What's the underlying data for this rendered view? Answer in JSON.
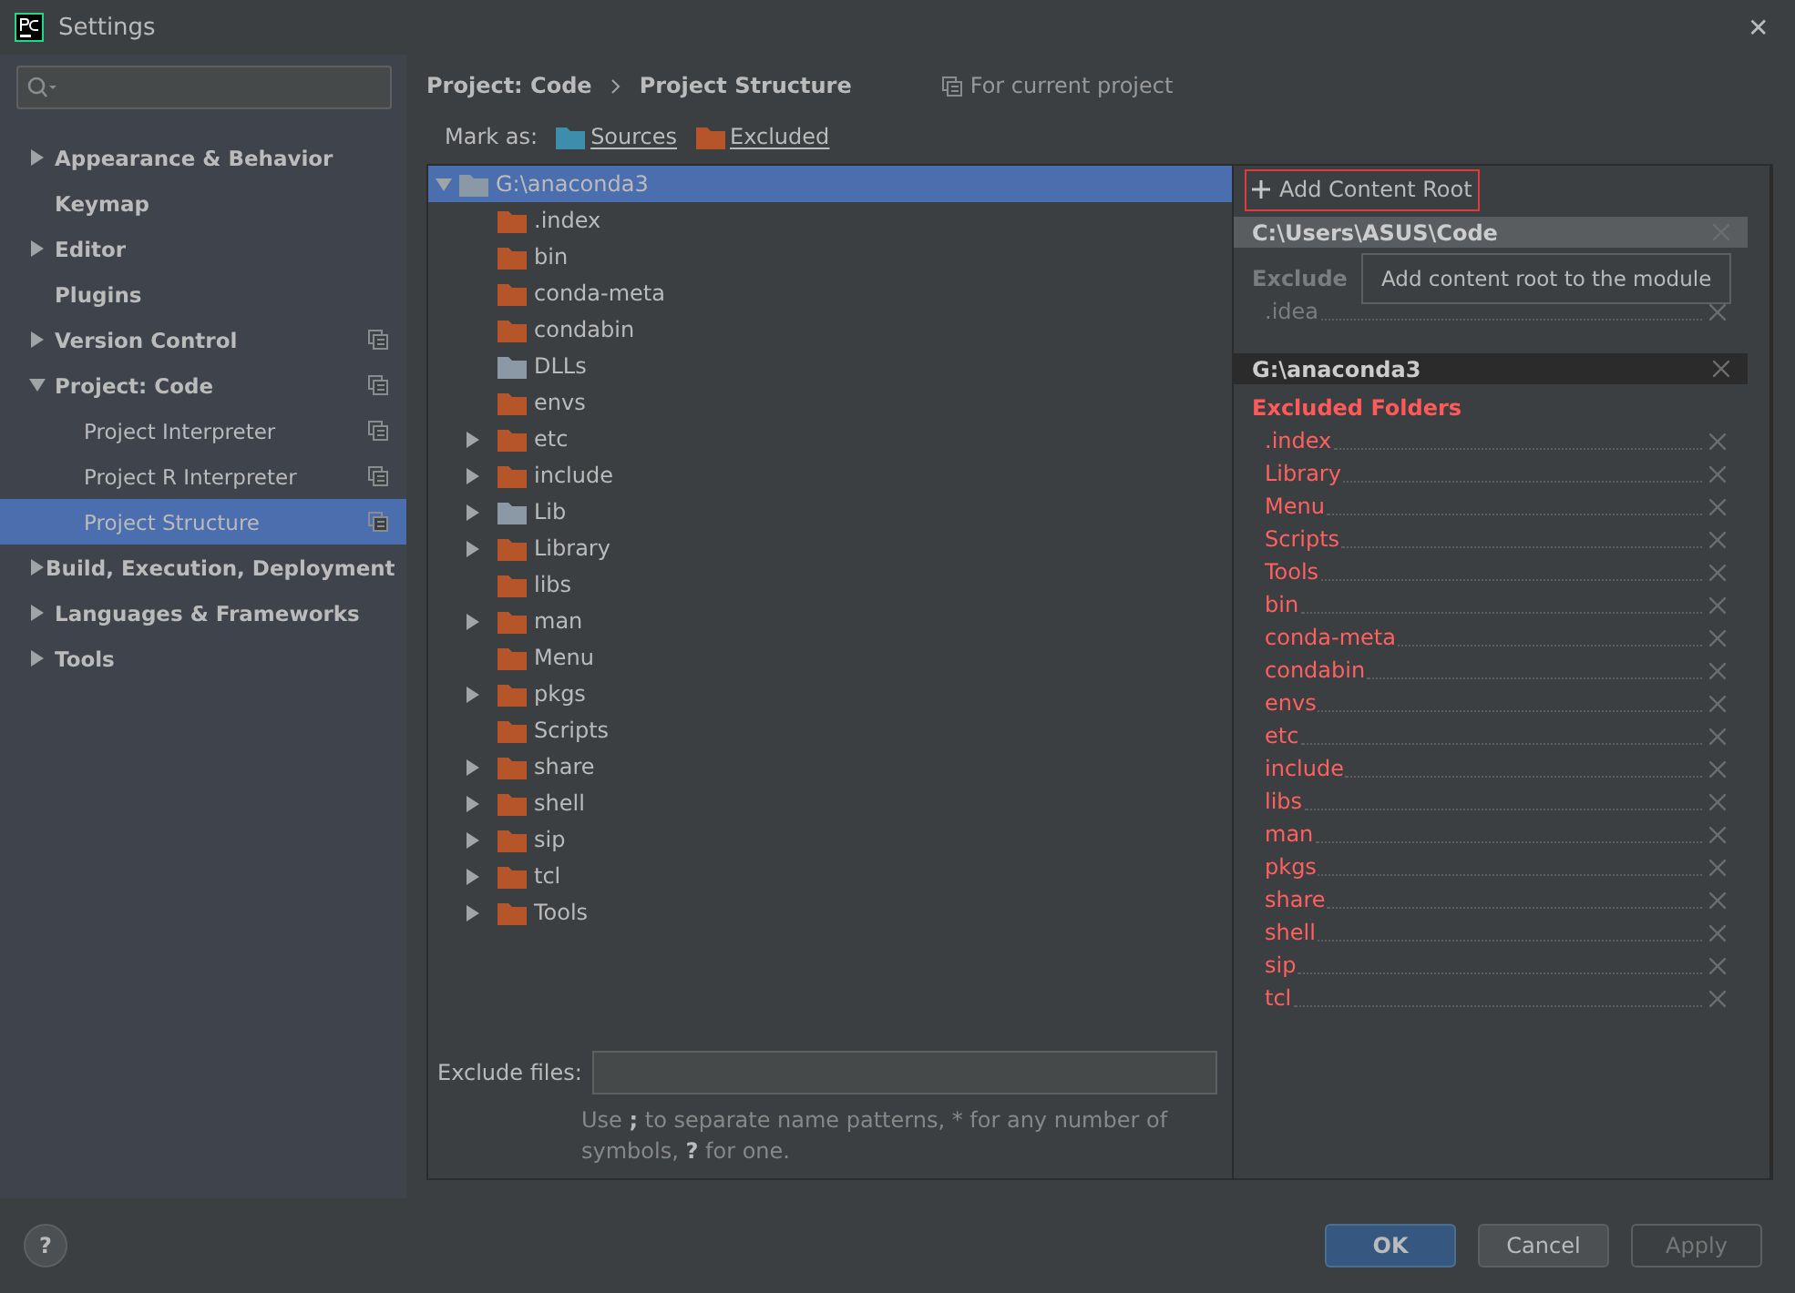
{
  "window": {
    "title": "Settings",
    "close": "✕"
  },
  "sidebar": {
    "items": [
      {
        "label": "Appearance & Behavior",
        "expanded": false,
        "project_scoped": false,
        "selected": false
      },
      {
        "label": "Keymap",
        "project_scoped": false,
        "selected": false
      },
      {
        "label": "Editor",
        "expanded": false,
        "project_scoped": false,
        "selected": false
      },
      {
        "label": "Plugins",
        "project_scoped": false,
        "selected": false
      },
      {
        "label": "Version Control",
        "expanded": false,
        "project_scoped": true,
        "selected": false
      },
      {
        "label": "Project: Code",
        "expanded": true,
        "project_scoped": true,
        "selected": false,
        "children": [
          {
            "label": "Project Interpreter",
            "project_scoped": true,
            "selected": false
          },
          {
            "label": "Project R Interpreter",
            "project_scoped": true,
            "selected": false
          },
          {
            "label": "Project Structure",
            "project_scoped": true,
            "selected": true
          }
        ]
      },
      {
        "label": "Build, Execution, Deployment",
        "expanded": false,
        "project_scoped": false,
        "selected": false
      },
      {
        "label": "Languages & Frameworks",
        "expanded": false,
        "project_scoped": false,
        "selected": false
      },
      {
        "label": "Tools",
        "expanded": false,
        "project_scoped": false,
        "selected": false
      }
    ]
  },
  "breadcrumb": [
    "Project: Code",
    "Project Structure"
  ],
  "scope_note": "For current project",
  "mark_as": {
    "label": "Mark as:",
    "options": [
      {
        "label": "Sources",
        "kind": "sources"
      },
      {
        "label": "Excluded",
        "kind": "excluded"
      }
    ]
  },
  "tree": {
    "root": {
      "label": "G:\\anaconda3",
      "expanded": true,
      "selected": true,
      "excluded": false
    },
    "children": [
      {
        "label": ".index",
        "excluded": true,
        "expandable": false
      },
      {
        "label": "bin",
        "excluded": true,
        "expandable": false
      },
      {
        "label": "conda-meta",
        "excluded": true,
        "expandable": false
      },
      {
        "label": "condabin",
        "excluded": true,
        "expandable": false
      },
      {
        "label": "DLLs",
        "excluded": false,
        "expandable": false
      },
      {
        "label": "envs",
        "excluded": true,
        "expandable": false
      },
      {
        "label": "etc",
        "excluded": true,
        "expandable": true
      },
      {
        "label": "include",
        "excluded": true,
        "expandable": true
      },
      {
        "label": "Lib",
        "excluded": false,
        "expandable": true
      },
      {
        "label": "Library",
        "excluded": true,
        "expandable": true
      },
      {
        "label": "libs",
        "excluded": true,
        "expandable": false
      },
      {
        "label": "man",
        "excluded": true,
        "expandable": true
      },
      {
        "label": "Menu",
        "excluded": true,
        "expandable": false
      },
      {
        "label": "pkgs",
        "excluded": true,
        "expandable": true
      },
      {
        "label": "Scripts",
        "excluded": true,
        "expandable": false
      },
      {
        "label": "share",
        "excluded": true,
        "expandable": true
      },
      {
        "label": "shell",
        "excluded": true,
        "expandable": true
      },
      {
        "label": "sip",
        "excluded": true,
        "expandable": true
      },
      {
        "label": "tcl",
        "excluded": true,
        "expandable": true
      },
      {
        "label": "Tools",
        "excluded": true,
        "expandable": true
      }
    ]
  },
  "exclude_files": {
    "label": "Exclude files:",
    "hint": "Use **;** to separate name patterns, * for any number of symbols, **?** for one."
  },
  "content_roots": {
    "add_button": "Add Content Root",
    "tooltip": "Add content root to the module",
    "roots": [
      {
        "path": "C:\\Users\\ASUS\\Code",
        "selected": false,
        "heading": "Exclude",
        "folders": [
          ".idea"
        ]
      },
      {
        "path": "G:\\anaconda3",
        "selected": true,
        "heading": "Excluded Folders",
        "folders": [
          ".index",
          "Library",
          "Menu",
          "Scripts",
          "Tools",
          "bin",
          "conda-meta",
          "condabin",
          "envs",
          "etc",
          "include",
          "libs",
          "man",
          "pkgs",
          "share",
          "shell",
          "sip",
          "tcl"
        ]
      }
    ]
  },
  "buttons": [
    {
      "label": "OK",
      "kind": "primary",
      "disabled": false
    },
    {
      "label": "Cancel",
      "kind": "normal",
      "disabled": false
    },
    {
      "label": "Apply",
      "kind": "normal",
      "disabled": true
    }
  ],
  "help": "?"
}
